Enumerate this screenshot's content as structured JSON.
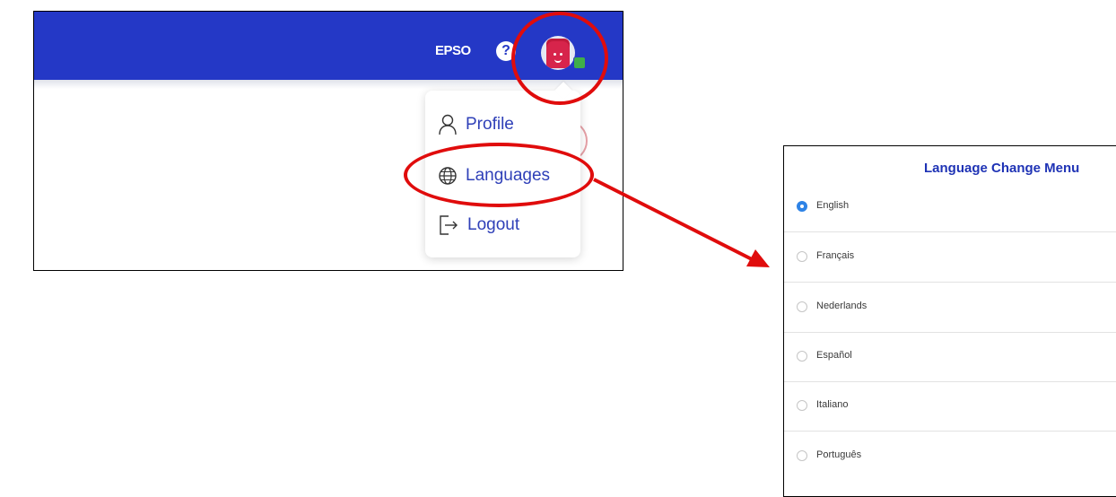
{
  "topbar": {
    "org_label": "EPSO",
    "help_glyph": "?",
    "bar_color": "#2438c6"
  },
  "user_menu": {
    "items": [
      {
        "label": "Profile",
        "icon": "person-icon"
      },
      {
        "label": "Languages",
        "icon": "globe-icon"
      },
      {
        "label": "Logout",
        "icon": "logout-icon"
      }
    ],
    "text_color": "#2f40b8"
  },
  "annotations": {
    "highlight_color": "#e00c0c"
  },
  "language_panel": {
    "title": "Language Change Menu",
    "options": [
      {
        "label": "English",
        "selected": true
      },
      {
        "label": "Français",
        "selected": false
      },
      {
        "label": "Nederlands",
        "selected": false
      },
      {
        "label": "Español",
        "selected": false
      },
      {
        "label": "Italiano",
        "selected": false
      },
      {
        "label": "Português",
        "selected": false
      }
    ],
    "accent_color": "#2e83e6"
  }
}
